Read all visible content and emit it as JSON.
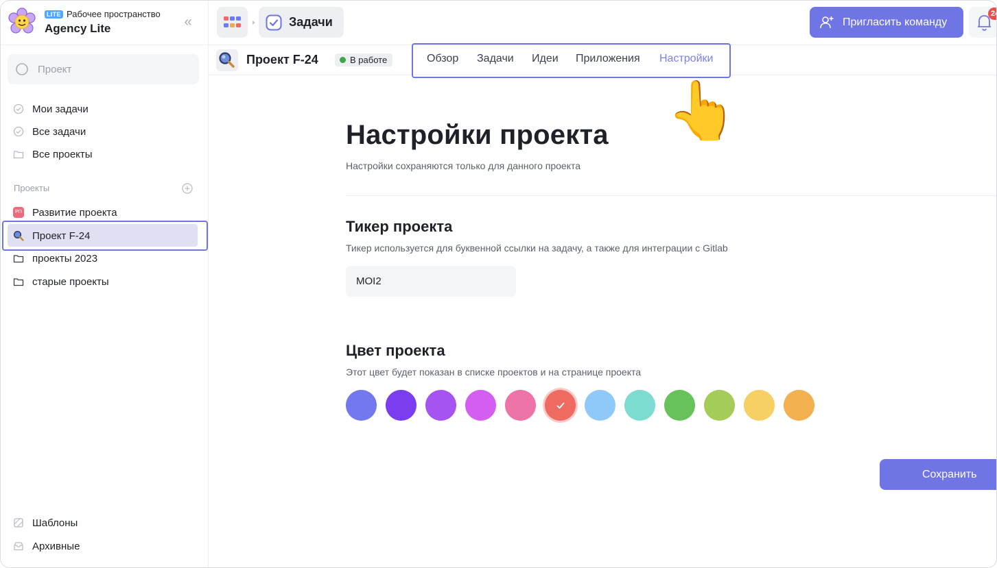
{
  "workspace": {
    "badge": "LITE",
    "caption": "Рабочее пространство",
    "name": "Agency Lite"
  },
  "sidebar": {
    "search_placeholder": "Проект",
    "nav": [
      {
        "label": "Мои задачи",
        "icon": "check-circle-icon"
      },
      {
        "label": "Все задачи",
        "icon": "check-circle-icon"
      },
      {
        "label": "Все проекты",
        "icon": "folder-icon"
      }
    ],
    "projects_title": "Проекты",
    "projects": [
      {
        "label": "Развитие проекта",
        "avatar": "РП",
        "color": "#eb6b7e"
      },
      {
        "label": "Проект F-24",
        "selected": true
      },
      {
        "label": "проекты 2023",
        "icon": "folder-icon"
      },
      {
        "label": "старые проекты",
        "icon": "folder-icon"
      }
    ],
    "bottom": [
      {
        "label": "Шаблоны",
        "icon": "template-icon"
      },
      {
        "label": "Архивные",
        "icon": "archive-icon"
      }
    ]
  },
  "topbar": {
    "tasks_label": "Задачи",
    "invite_label": "Пригласить команду",
    "notifications_count": "24"
  },
  "project": {
    "title": "Проект F-24",
    "status": "В работе",
    "status_color": "#3ea548",
    "tabs": [
      "Обзор",
      "Задачи",
      "Идеи",
      "Приложения",
      "Настройки"
    ],
    "active_tab": "Настройки"
  },
  "settings": {
    "title": "Настройки проекта",
    "subtitle": "Настройки сохраняются только для данного проекта",
    "ticker": {
      "title": "Тикер проекта",
      "description": "Тикер используется для буквенной ссылки на задачу, а также для интеграции с Gitlab",
      "value": "MOI2"
    },
    "color": {
      "title": "Цвет проекта",
      "description": "Этот цвет будет показан в списке проектов и на странице проекта",
      "swatches": [
        "#7278ee",
        "#7a3df0",
        "#a554f2",
        "#d45ef0",
        "#ee73a6",
        "#ef6b62",
        "#8ec9fa",
        "#7cdccf",
        "#67c25b",
        "#a3cc59",
        "#f7d065",
        "#f2b14e"
      ],
      "selected_index": 5
    },
    "save_label": "Сохранить"
  },
  "accent": "#6f75e5"
}
